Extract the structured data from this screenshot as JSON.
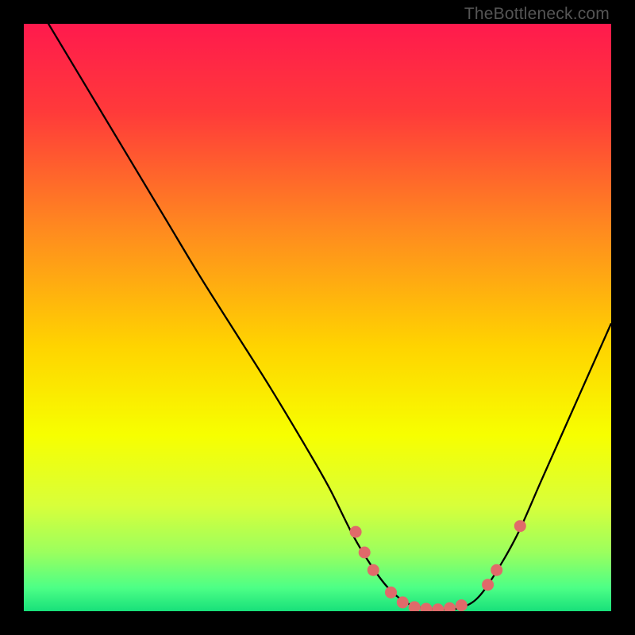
{
  "watermark": "TheBottleneck.com",
  "chart_data": {
    "type": "line",
    "title": "",
    "xlabel": "",
    "ylabel": "",
    "xlim": [
      0,
      100
    ],
    "ylim": [
      0,
      100
    ],
    "grid": false,
    "legend": false,
    "background_gradient": {
      "stops": [
        {
          "offset": 0.0,
          "color": "#ff1a4d"
        },
        {
          "offset": 0.15,
          "color": "#ff3a3a"
        },
        {
          "offset": 0.35,
          "color": "#ff8a1f"
        },
        {
          "offset": 0.55,
          "color": "#ffd400"
        },
        {
          "offset": 0.7,
          "color": "#f7ff00"
        },
        {
          "offset": 0.82,
          "color": "#d8ff3a"
        },
        {
          "offset": 0.9,
          "color": "#9bff5e"
        },
        {
          "offset": 0.96,
          "color": "#4dff86"
        },
        {
          "offset": 1.0,
          "color": "#18e07a"
        }
      ]
    },
    "series": [
      {
        "name": "curve",
        "stroke": "#000000",
        "stroke_width": 2.3,
        "x": [
          0,
          6,
          12,
          18,
          24,
          30,
          36,
          42,
          48,
          52,
          56,
          59,
          62,
          65,
          68,
          71,
          74,
          77,
          80,
          84,
          88,
          92,
          96,
          100
        ],
        "y": [
          107,
          97,
          87,
          77,
          67,
          57,
          47.5,
          38,
          28,
          21,
          13,
          8,
          4,
          1.5,
          0.5,
          0.3,
          0.5,
          2,
          6,
          13,
          22,
          31,
          40,
          49
        ]
      }
    ],
    "markers": {
      "color": "#e06a6a",
      "radius": 7.5,
      "points": [
        {
          "x": 56.5,
          "y": 13.5
        },
        {
          "x": 58.0,
          "y": 10.0
        },
        {
          "x": 59.5,
          "y": 7.0
        },
        {
          "x": 62.5,
          "y": 3.2
        },
        {
          "x": 64.5,
          "y": 1.5
        },
        {
          "x": 66.5,
          "y": 0.7
        },
        {
          "x": 68.5,
          "y": 0.4
        },
        {
          "x": 70.5,
          "y": 0.3
        },
        {
          "x": 72.5,
          "y": 0.5
        },
        {
          "x": 74.5,
          "y": 1.0
        },
        {
          "x": 79.0,
          "y": 4.5
        },
        {
          "x": 80.5,
          "y": 7.0
        },
        {
          "x": 84.5,
          "y": 14.5
        }
      ]
    }
  }
}
